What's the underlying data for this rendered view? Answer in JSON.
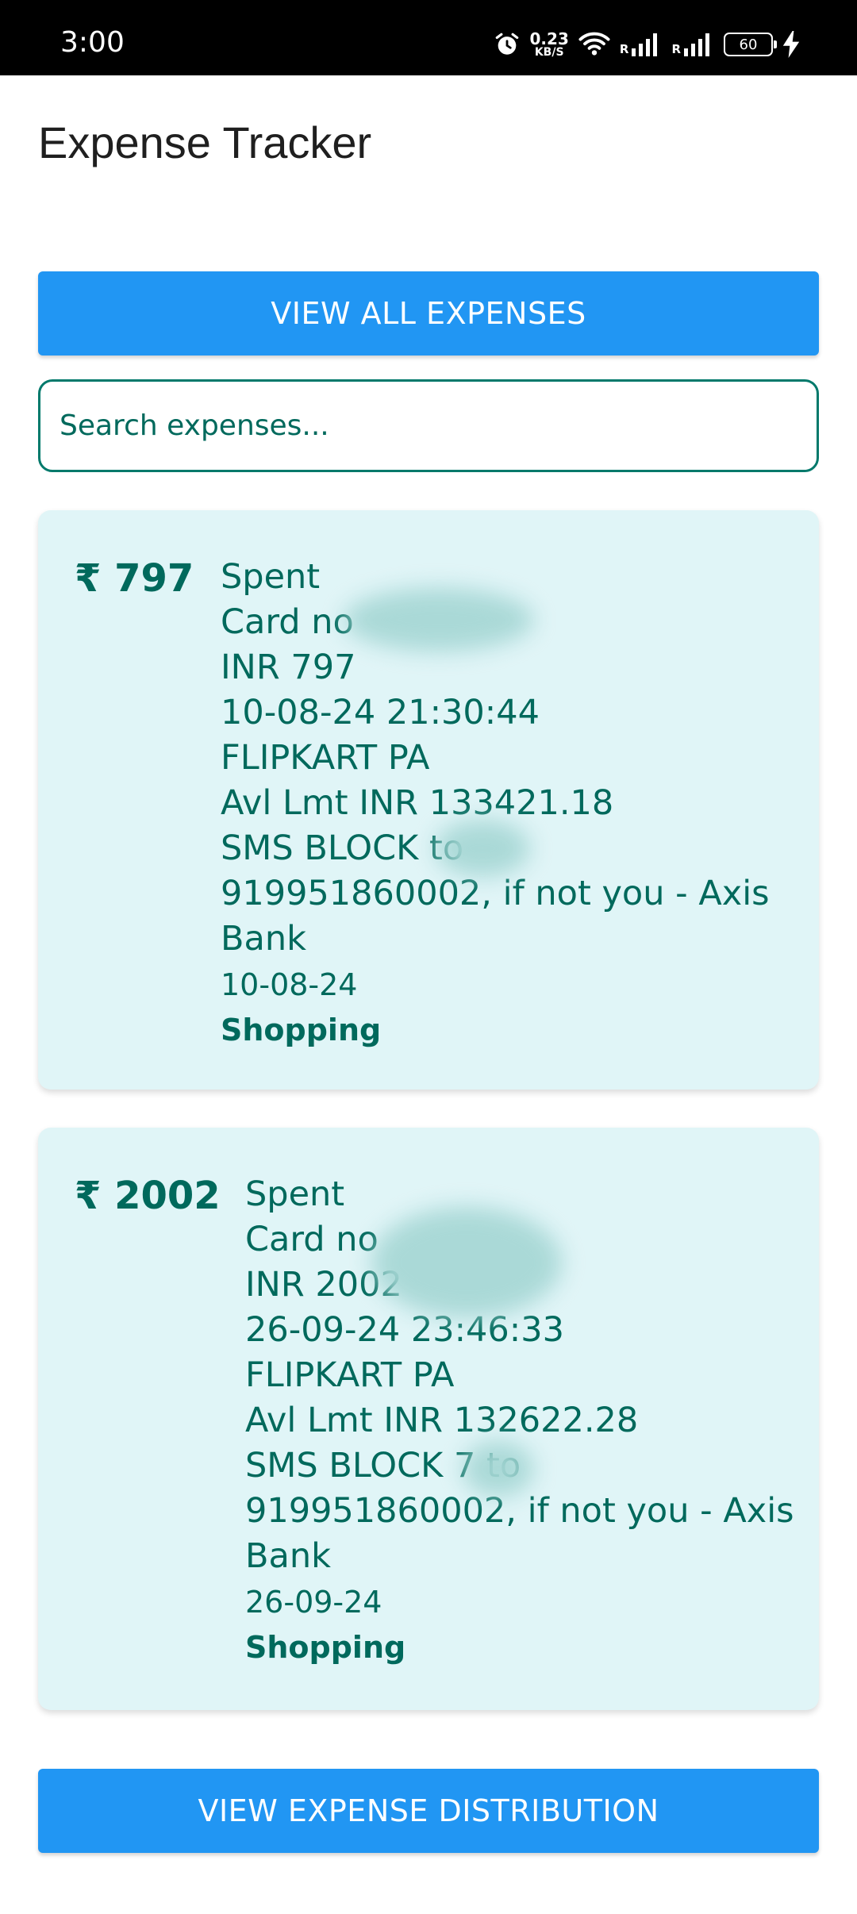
{
  "status_bar": {
    "time": "3:00",
    "net_speed_value": "0.23",
    "net_speed_unit": "KB/S",
    "signal_1_label": "R",
    "signal_2_label": "R",
    "battery": "60"
  },
  "app_bar": {
    "title": "Expense Tracker"
  },
  "actions": {
    "view_all_label": "VIEW ALL EXPENSES",
    "distribution_label": "VIEW EXPENSE DISTRIBUTION"
  },
  "search": {
    "placeholder": "Search expenses..."
  },
  "expenses": [
    {
      "amount": "₹ 797",
      "message": "Spent\nCard no\nINR 797\n10-08-24 21:30:44\nFLIPKART PA\nAvl Lmt INR 133421.18\nSMS BLOCK       to\n919951860002, if not you - Axis Bank",
      "date": "10-08-24",
      "category": "Shopping"
    },
    {
      "amount": "₹ 2002",
      "message": "Spent\nCard no\nINR 2002\n26-09-24 23:46:33\nFLIPKART PA\nAvl Lmt INR 132622.28\nSMS BLOCK     7 to\n919951860002, if not you - Axis Bank",
      "date": "26-09-24",
      "category": "Shopping"
    }
  ],
  "colors": {
    "accent": "#2196f3",
    "primary_text": "#00695c",
    "card_bg": "#e0f5f7"
  }
}
